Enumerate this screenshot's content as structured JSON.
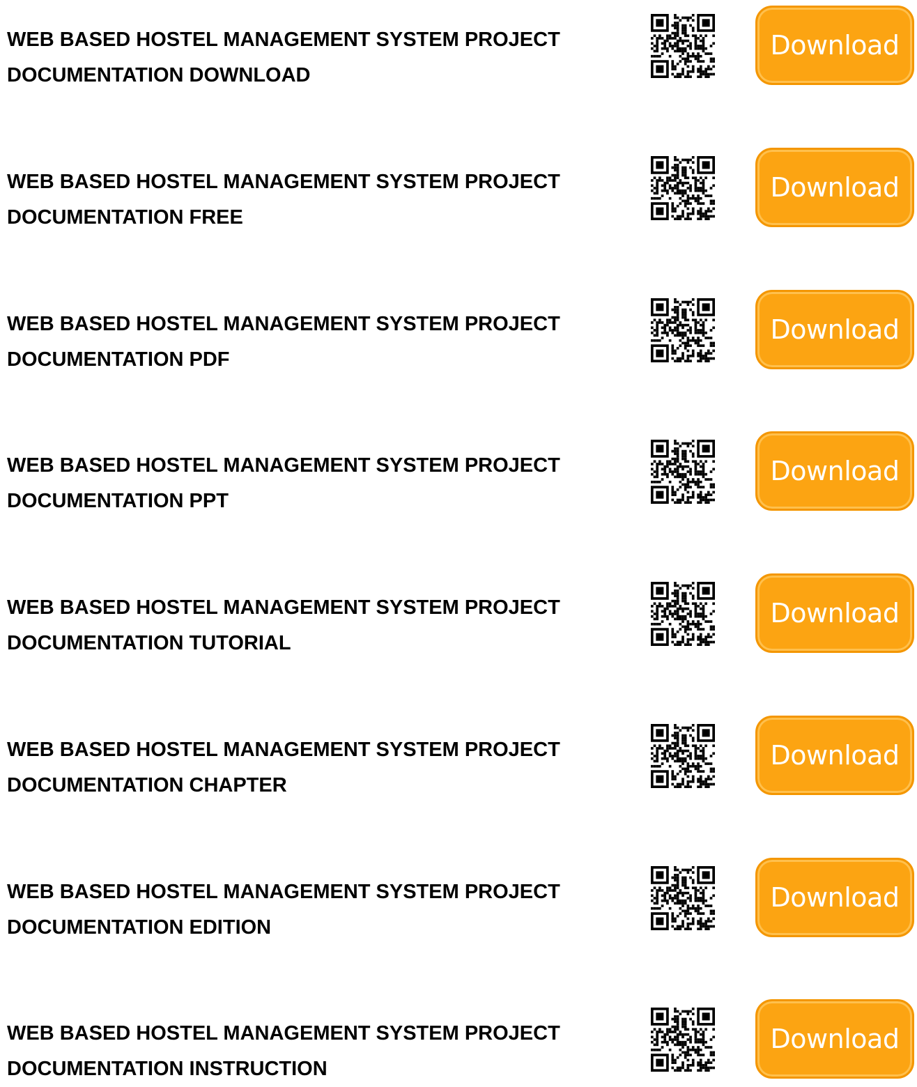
{
  "colors": {
    "button_fill": "#fca412",
    "button_border": "#f49600",
    "button_text": "#ffffff",
    "title_text": "#000000"
  },
  "items": [
    {
      "line1": "WEB BASED HOSTEL MANAGEMENT SYSTEM PROJECT",
      "line2": "DOCUMENTATION DOWNLOAD",
      "button_label": "Download",
      "icon": "qr-code-icon"
    },
    {
      "line1": "WEB BASED HOSTEL MANAGEMENT SYSTEM PROJECT",
      "line2": "DOCUMENTATION FREE",
      "button_label": "Download",
      "icon": "qr-code-icon"
    },
    {
      "line1": "WEB BASED HOSTEL MANAGEMENT SYSTEM PROJECT",
      "line2": "DOCUMENTATION PDF",
      "button_label": "Download",
      "icon": "qr-code-icon"
    },
    {
      "line1": "WEB BASED HOSTEL MANAGEMENT SYSTEM PROJECT",
      "line2": "DOCUMENTATION PPT",
      "button_label": "Download",
      "icon": "qr-code-icon"
    },
    {
      "line1": "WEB BASED HOSTEL MANAGEMENT SYSTEM PROJECT",
      "line2": "DOCUMENTATION TUTORIAL",
      "button_label": "Download",
      "icon": "qr-code-icon"
    },
    {
      "line1": "WEB BASED HOSTEL MANAGEMENT SYSTEM PROJECT",
      "line2": "DOCUMENTATION CHAPTER",
      "button_label": "Download",
      "icon": "qr-code-icon"
    },
    {
      "line1": "WEB BASED HOSTEL MANAGEMENT SYSTEM PROJECT",
      "line2": "DOCUMENTATION EDITION",
      "button_label": "Download",
      "icon": "qr-code-icon"
    },
    {
      "line1": "WEB BASED HOSTEL MANAGEMENT SYSTEM PROJECT",
      "line2": "DOCUMENTATION INSTRUCTION",
      "button_label": "Download",
      "icon": "qr-code-icon"
    }
  ]
}
